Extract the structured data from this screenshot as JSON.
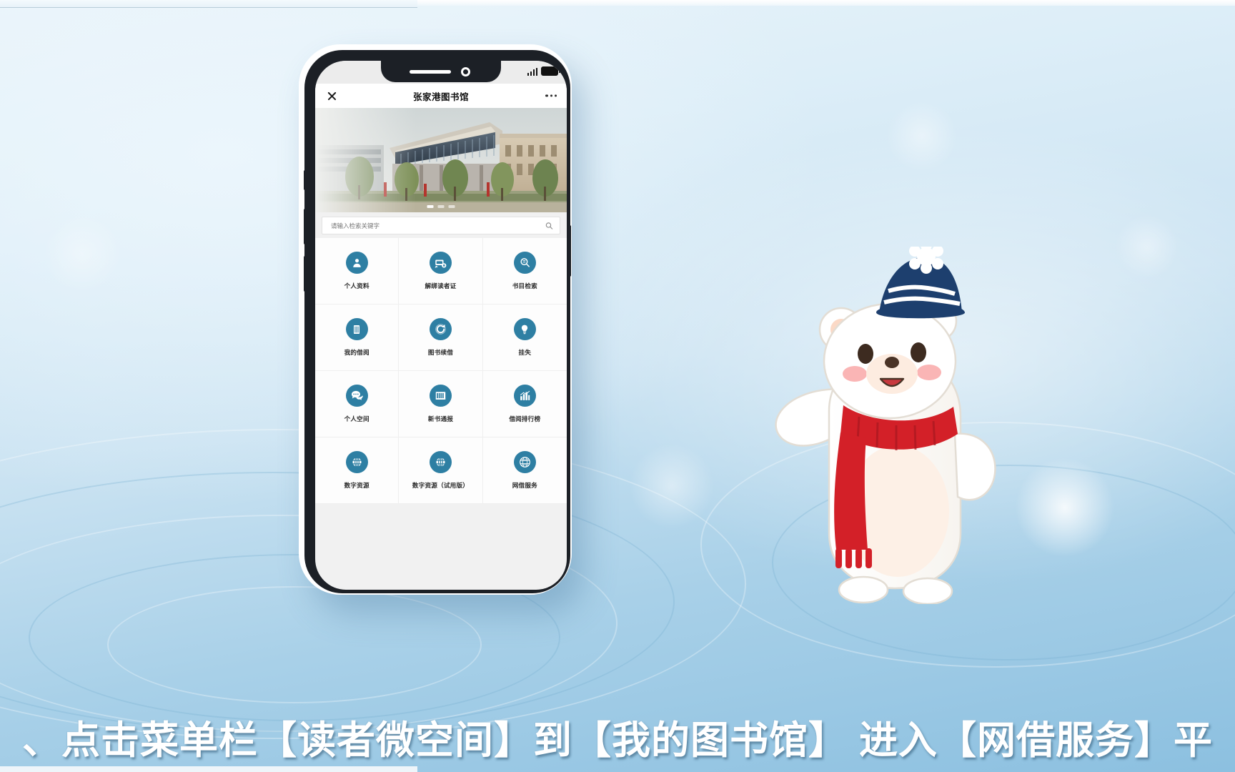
{
  "background": {
    "accent": "#8cc0e0",
    "top_strip_color": "#eef6fb"
  },
  "phone": {
    "status_bar": {
      "signal_icon": "signal-bars-icon",
      "battery_icon": "battery-full-icon"
    },
    "nav": {
      "close_icon": "close-icon",
      "title": "张家港图书馆",
      "more_icon": "more-dots-icon"
    },
    "hero": {
      "alt": "library-building-photo",
      "carousel_dots": 3,
      "active_dot": 0
    },
    "search": {
      "placeholder": "请输入检索关键字",
      "value": "",
      "icon": "search-icon"
    },
    "grid": {
      "items": [
        {
          "label": "个人资料",
          "icon": "user-profile-icon"
        },
        {
          "label": "解绑读者证",
          "icon": "card-unbind-icon"
        },
        {
          "label": "书目检索",
          "icon": "book-search-icon"
        },
        {
          "label": "我的借阅",
          "icon": "my-loans-icon"
        },
        {
          "label": "图书续借",
          "icon": "renew-book-icon"
        },
        {
          "label": "挂失",
          "icon": "report-loss-icon"
        },
        {
          "label": "个人空间",
          "icon": "personal-space-icon"
        },
        {
          "label": "新书通报",
          "icon": "new-books-icon"
        },
        {
          "label": "借阅排行榜",
          "icon": "ranking-chart-icon"
        },
        {
          "label": "数字资源",
          "icon": "globe-icon"
        },
        {
          "label": "数字资源（试用版）",
          "icon": "globe-icon"
        },
        {
          "label": "网借服务",
          "icon": "web-lending-icon"
        }
      ],
      "icon_color": "#2e7fa3"
    }
  },
  "mascot": {
    "name": "polar-bear-mascot",
    "hat_color": "#1d3f6e",
    "scarf_color": "#d32028",
    "body_color": "#ffffff"
  },
  "caption": {
    "text": "、点击菜单栏【读者微空间】到【我的图书馆】 进入【网借服务】平"
  }
}
